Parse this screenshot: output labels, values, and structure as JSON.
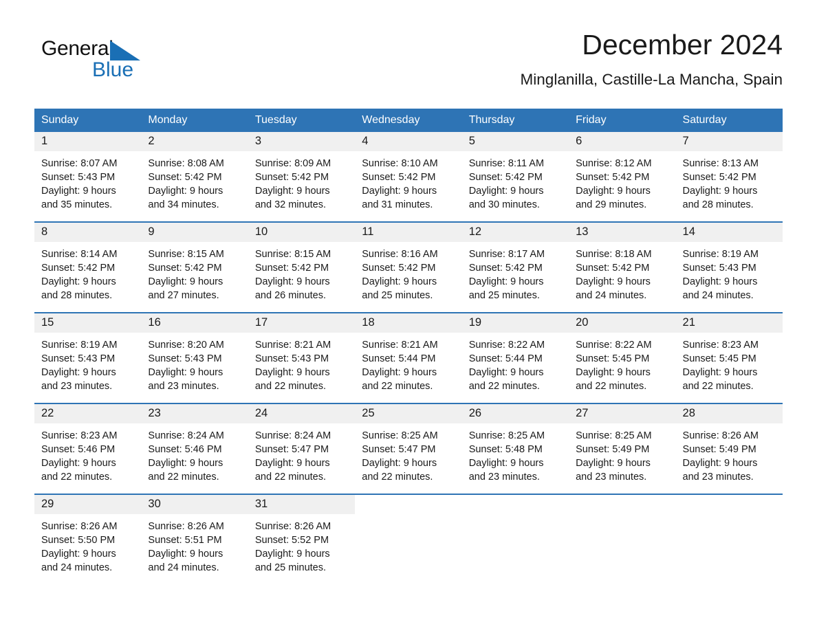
{
  "brand": {
    "name_part1": "General",
    "name_part2": "Blue",
    "logo_icon": "triangle-flag-icon",
    "accent_color": "#1a6fb5"
  },
  "header": {
    "month_title": "December 2024",
    "location": "Minglanilla, Castille-La Mancha, Spain",
    "header_bar_color": "#2e74b5",
    "daynum_band_color": "#f0f0f0"
  },
  "calendar": {
    "weekday_headers": [
      "Sunday",
      "Monday",
      "Tuesday",
      "Wednesday",
      "Thursday",
      "Friday",
      "Saturday"
    ],
    "weeks": [
      [
        {
          "day": "1",
          "sunrise": "Sunrise: 8:07 AM",
          "sunset": "Sunset: 5:43 PM",
          "daylight": "Daylight: 9 hours and 35 minutes."
        },
        {
          "day": "2",
          "sunrise": "Sunrise: 8:08 AM",
          "sunset": "Sunset: 5:42 PM",
          "daylight": "Daylight: 9 hours and 34 minutes."
        },
        {
          "day": "3",
          "sunrise": "Sunrise: 8:09 AM",
          "sunset": "Sunset: 5:42 PM",
          "daylight": "Daylight: 9 hours and 32 minutes."
        },
        {
          "day": "4",
          "sunrise": "Sunrise: 8:10 AM",
          "sunset": "Sunset: 5:42 PM",
          "daylight": "Daylight: 9 hours and 31 minutes."
        },
        {
          "day": "5",
          "sunrise": "Sunrise: 8:11 AM",
          "sunset": "Sunset: 5:42 PM",
          "daylight": "Daylight: 9 hours and 30 minutes."
        },
        {
          "day": "6",
          "sunrise": "Sunrise: 8:12 AM",
          "sunset": "Sunset: 5:42 PM",
          "daylight": "Daylight: 9 hours and 29 minutes."
        },
        {
          "day": "7",
          "sunrise": "Sunrise: 8:13 AM",
          "sunset": "Sunset: 5:42 PM",
          "daylight": "Daylight: 9 hours and 28 minutes."
        }
      ],
      [
        {
          "day": "8",
          "sunrise": "Sunrise: 8:14 AM",
          "sunset": "Sunset: 5:42 PM",
          "daylight": "Daylight: 9 hours and 28 minutes."
        },
        {
          "day": "9",
          "sunrise": "Sunrise: 8:15 AM",
          "sunset": "Sunset: 5:42 PM",
          "daylight": "Daylight: 9 hours and 27 minutes."
        },
        {
          "day": "10",
          "sunrise": "Sunrise: 8:15 AM",
          "sunset": "Sunset: 5:42 PM",
          "daylight": "Daylight: 9 hours and 26 minutes."
        },
        {
          "day": "11",
          "sunrise": "Sunrise: 8:16 AM",
          "sunset": "Sunset: 5:42 PM",
          "daylight": "Daylight: 9 hours and 25 minutes."
        },
        {
          "day": "12",
          "sunrise": "Sunrise: 8:17 AM",
          "sunset": "Sunset: 5:42 PM",
          "daylight": "Daylight: 9 hours and 25 minutes."
        },
        {
          "day": "13",
          "sunrise": "Sunrise: 8:18 AM",
          "sunset": "Sunset: 5:42 PM",
          "daylight": "Daylight: 9 hours and 24 minutes."
        },
        {
          "day": "14",
          "sunrise": "Sunrise: 8:19 AM",
          "sunset": "Sunset: 5:43 PM",
          "daylight": "Daylight: 9 hours and 24 minutes."
        }
      ],
      [
        {
          "day": "15",
          "sunrise": "Sunrise: 8:19 AM",
          "sunset": "Sunset: 5:43 PM",
          "daylight": "Daylight: 9 hours and 23 minutes."
        },
        {
          "day": "16",
          "sunrise": "Sunrise: 8:20 AM",
          "sunset": "Sunset: 5:43 PM",
          "daylight": "Daylight: 9 hours and 23 minutes."
        },
        {
          "day": "17",
          "sunrise": "Sunrise: 8:21 AM",
          "sunset": "Sunset: 5:43 PM",
          "daylight": "Daylight: 9 hours and 22 minutes."
        },
        {
          "day": "18",
          "sunrise": "Sunrise: 8:21 AM",
          "sunset": "Sunset: 5:44 PM",
          "daylight": "Daylight: 9 hours and 22 minutes."
        },
        {
          "day": "19",
          "sunrise": "Sunrise: 8:22 AM",
          "sunset": "Sunset: 5:44 PM",
          "daylight": "Daylight: 9 hours and 22 minutes."
        },
        {
          "day": "20",
          "sunrise": "Sunrise: 8:22 AM",
          "sunset": "Sunset: 5:45 PM",
          "daylight": "Daylight: 9 hours and 22 minutes."
        },
        {
          "day": "21",
          "sunrise": "Sunrise: 8:23 AM",
          "sunset": "Sunset: 5:45 PM",
          "daylight": "Daylight: 9 hours and 22 minutes."
        }
      ],
      [
        {
          "day": "22",
          "sunrise": "Sunrise: 8:23 AM",
          "sunset": "Sunset: 5:46 PM",
          "daylight": "Daylight: 9 hours and 22 minutes."
        },
        {
          "day": "23",
          "sunrise": "Sunrise: 8:24 AM",
          "sunset": "Sunset: 5:46 PM",
          "daylight": "Daylight: 9 hours and 22 minutes."
        },
        {
          "day": "24",
          "sunrise": "Sunrise: 8:24 AM",
          "sunset": "Sunset: 5:47 PM",
          "daylight": "Daylight: 9 hours and 22 minutes."
        },
        {
          "day": "25",
          "sunrise": "Sunrise: 8:25 AM",
          "sunset": "Sunset: 5:47 PM",
          "daylight": "Daylight: 9 hours and 22 minutes."
        },
        {
          "day": "26",
          "sunrise": "Sunrise: 8:25 AM",
          "sunset": "Sunset: 5:48 PM",
          "daylight": "Daylight: 9 hours and 23 minutes."
        },
        {
          "day": "27",
          "sunrise": "Sunrise: 8:25 AM",
          "sunset": "Sunset: 5:49 PM",
          "daylight": "Daylight: 9 hours and 23 minutes."
        },
        {
          "day": "28",
          "sunrise": "Sunrise: 8:26 AM",
          "sunset": "Sunset: 5:49 PM",
          "daylight": "Daylight: 9 hours and 23 minutes."
        }
      ],
      [
        {
          "day": "29",
          "sunrise": "Sunrise: 8:26 AM",
          "sunset": "Sunset: 5:50 PM",
          "daylight": "Daylight: 9 hours and 24 minutes."
        },
        {
          "day": "30",
          "sunrise": "Sunrise: 8:26 AM",
          "sunset": "Sunset: 5:51 PM",
          "daylight": "Daylight: 9 hours and 24 minutes."
        },
        {
          "day": "31",
          "sunrise": "Sunrise: 8:26 AM",
          "sunset": "Sunset: 5:52 PM",
          "daylight": "Daylight: 9 hours and 25 minutes."
        },
        {
          "day": "",
          "sunrise": "",
          "sunset": "",
          "daylight": ""
        },
        {
          "day": "",
          "sunrise": "",
          "sunset": "",
          "daylight": ""
        },
        {
          "day": "",
          "sunrise": "",
          "sunset": "",
          "daylight": ""
        },
        {
          "day": "",
          "sunrise": "",
          "sunset": "",
          "daylight": ""
        }
      ]
    ]
  }
}
